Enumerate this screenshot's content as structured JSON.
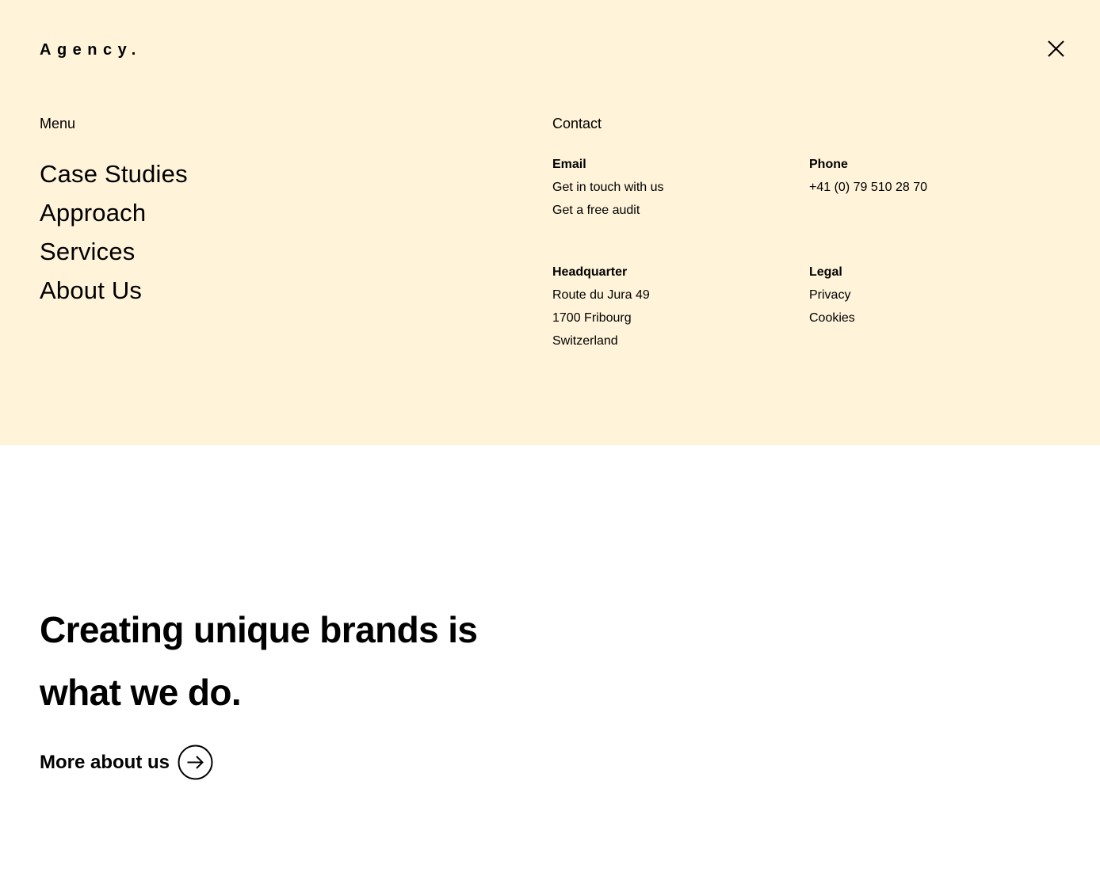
{
  "header": {
    "logo": "Agency.",
    "close_icon": "close-icon"
  },
  "menu": {
    "heading": "Menu",
    "items": [
      {
        "label": "Case Studies"
      },
      {
        "label": "Approach"
      },
      {
        "label": "Services"
      },
      {
        "label": "About Us"
      }
    ]
  },
  "contact": {
    "heading": "Contact",
    "email": {
      "label": "Email",
      "links": [
        "Get in touch with us",
        "Get a free audit"
      ]
    },
    "phone": {
      "label": "Phone",
      "number": "+41 (0) 79 510 28 70"
    },
    "headquarter": {
      "label": "Headquarter",
      "lines": [
        "Route du Jura 49",
        "1700 Fribourg",
        "Switzerland"
      ]
    },
    "legal": {
      "label": "Legal",
      "links": [
        "Privacy",
        "Cookies"
      ]
    }
  },
  "hero": {
    "title": "Creating unique brands is what we do.",
    "cta_label": "More about us",
    "cta_icon": "arrow-right-circle-icon"
  },
  "colors": {
    "menu_background": "#fff3d9",
    "page_background": "#ffffff",
    "text": "#000000"
  }
}
